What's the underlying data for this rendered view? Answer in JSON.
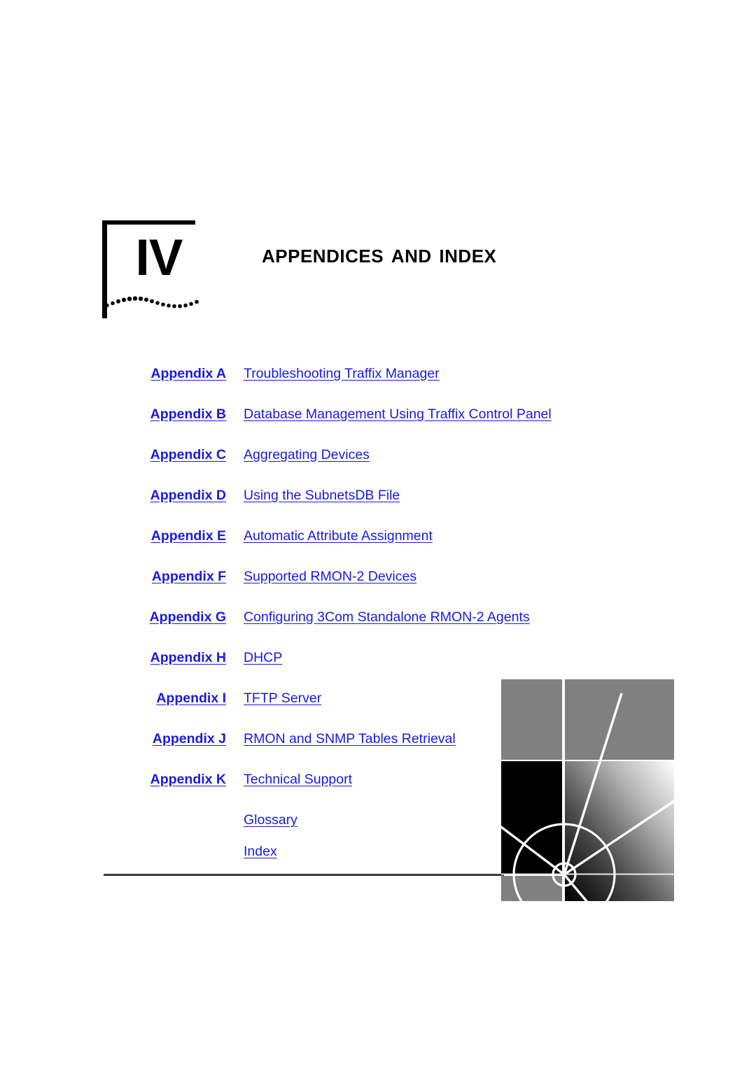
{
  "page": {
    "part_number": "IV",
    "part_title": "Appendices and Index"
  },
  "colors": {
    "link_blue": "#1a1ae0",
    "rule_gray": "#3d3d3d",
    "art_gray": "#808080",
    "art_black": "#000000",
    "page_background": "#ffffff"
  },
  "toc": {
    "entries": [
      {
        "label": "Appendix A",
        "title": "Troubleshooting Traffix Manager"
      },
      {
        "label": "Appendix B",
        "title": "Database Management Using Traffix Control Panel"
      },
      {
        "label": "Appendix C",
        "title": "Aggregating Devices"
      },
      {
        "label": "Appendix D",
        "title": "Using the SubnetsDB File"
      },
      {
        "label": "Appendix E",
        "title": "Automatic Attribute Assignment"
      },
      {
        "label": "Appendix F",
        "title": "Supported RMON-2 Devices"
      },
      {
        "label": "Appendix G",
        "title": "Configuring 3Com Standalone RMON-2 Agents"
      },
      {
        "label": "Appendix H",
        "title": "DHCP"
      },
      {
        "label": "Appendix I",
        "title": "TFTP Server"
      },
      {
        "label": "Appendix J",
        "title": "RMON and SNMP Tables Retrieval"
      },
      {
        "label": "Appendix K",
        "title": "Technical Support"
      },
      {
        "label": "",
        "title": "Glossary"
      },
      {
        "label": "",
        "title": "Index"
      }
    ]
  }
}
